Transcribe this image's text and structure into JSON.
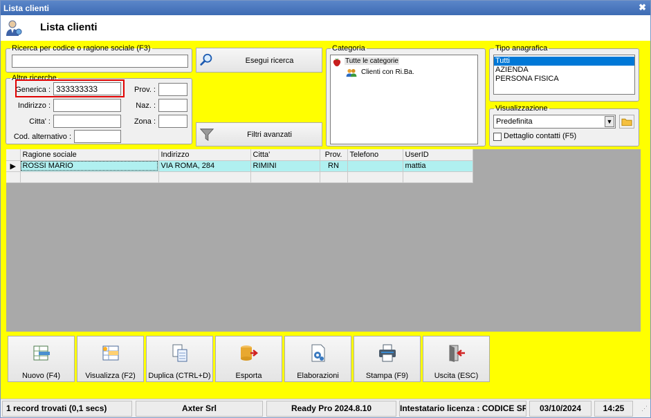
{
  "window": {
    "title": "Lista clienti"
  },
  "header": {
    "title": "Lista clienti"
  },
  "search_code": {
    "legend": "Ricerca per codice o ragione sociale (F3)",
    "value": ""
  },
  "other": {
    "legend": "Altre ricerche",
    "generica_label": "Generica :",
    "generica_value": "333333333",
    "indirizzo_label": "Indirizzo :",
    "citta_label": "Citta' :",
    "cod_alt_label": "Cod. alternativo :",
    "prov_label": "Prov. :",
    "naz_label": "Naz. :",
    "zona_label": "Zona :"
  },
  "buttons": {
    "search": "Esegui ricerca",
    "filters": "Filtri avanzati"
  },
  "categoria": {
    "legend": "Categoria",
    "root": "Tutte le categorie",
    "child": "Clienti con Ri.Ba."
  },
  "tipo": {
    "legend": "Tipo anagrafica",
    "options": [
      "Tutti",
      "AZIENDA",
      "PERSONA FISICA"
    ]
  },
  "view": {
    "legend": "Visualizzazione",
    "selected": "Predefinita",
    "checkbox_label": "Dettaglio contatti (F5)"
  },
  "grid": {
    "columns": [
      "Ragione sociale",
      "Indirizzo",
      "Citta'",
      "Prov.",
      "Telefono",
      "UserID"
    ],
    "rows": [
      [
        "ROSSI MARIO",
        "VIA ROMA, 284",
        "RIMINI",
        "RN",
        "",
        "mattia"
      ]
    ]
  },
  "toolbar": [
    "Nuovo (F4)",
    "Visualizza (F2)",
    "Duplica (CTRL+D)",
    "Esporta",
    "Elaborazioni",
    "Stampa (F9)",
    "Uscita (ESC)"
  ],
  "status": [
    "1 record trovati (0,1 secs)",
    "Axter Srl",
    "Ready Pro 2024.8.10",
    "Intestatario licenza : CODICE SRL",
    "03/10/2024",
    "14:25"
  ],
  "colors": {
    "background_highlight": "#ffff00",
    "selected_row": "#b0f0f0",
    "selection": "#0078d7",
    "search_highlight_border": "#e00000"
  }
}
